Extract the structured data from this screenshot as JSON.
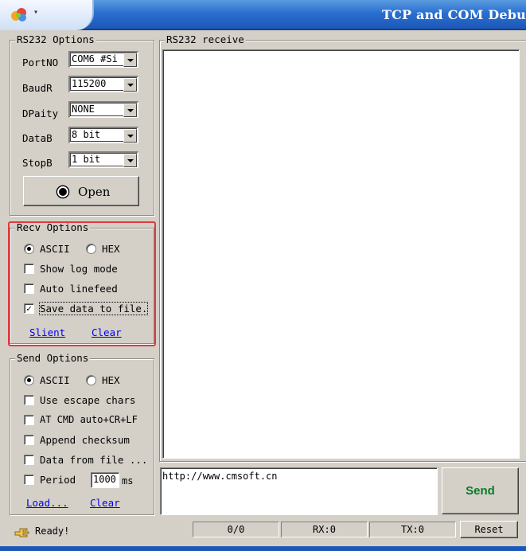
{
  "window": {
    "title": "TCP and COM Debu"
  },
  "rs232_options": {
    "legend": "RS232 Options",
    "port_label": "PortNO",
    "port_value": "COM6 #Si",
    "baud_label": "BaudR",
    "baud_value": "115200",
    "parity_label": "DPaity",
    "parity_value": "NONE",
    "databits_label": "DataB",
    "databits_value": "8 bit",
    "stopbits_label": "StopB",
    "stopbits_value": "1 bit",
    "open_label": "Open"
  },
  "recv_options": {
    "legend": "Recv Options",
    "ascii_label": "ASCII",
    "hex_label": "HEX",
    "selected_mode": "ASCII",
    "show_log_label": "Show log mode",
    "show_log_checked": false,
    "auto_linefeed_label": "Auto linefeed",
    "auto_linefeed_checked": false,
    "save_to_file_label": "Save data to file.",
    "save_to_file_checked": true,
    "silent_link": "Slient",
    "clear_link": "Clear",
    "highlight_color": "#e0393e"
  },
  "send_options": {
    "legend": "Send Options",
    "ascii_label": "ASCII",
    "hex_label": "HEX",
    "selected_mode": "ASCII",
    "escape_label": "Use escape chars",
    "atcmd_label": "AT CMD auto+CR+LF",
    "checksum_label": "Append checksum",
    "fromfile_label": "Data from file ...",
    "period_label": "Period",
    "period_value": "1000",
    "period_unit": "ms",
    "load_link": "Load...",
    "clear_link": "Clear"
  },
  "receive_panel": {
    "legend": "RS232 receive",
    "content": ""
  },
  "send_panel": {
    "input_value": "http://www.cmsoft.cn",
    "send_label": "Send",
    "send_color": "#0a7a2a"
  },
  "status_bar": {
    "ready_text": "Ready!",
    "counter": "0/0",
    "rx": "RX:0",
    "tx": "TX:0",
    "reset_label": "Reset"
  }
}
